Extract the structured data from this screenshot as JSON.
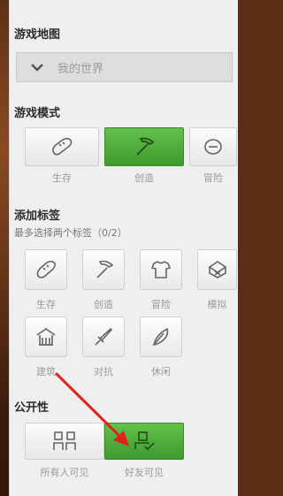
{
  "sections": {
    "map_title": "游戏地图",
    "mode_title": "游戏模式",
    "tags_title": "添加标签",
    "tags_hint": "最多选择两个标签（0/2）",
    "visibility_title": "公开性"
  },
  "map": {
    "selected": "我的世界"
  },
  "modes": [
    {
      "label": "生存",
      "icon": "bread-icon",
      "active": false
    },
    {
      "label": "创造",
      "icon": "pickaxe-icon",
      "active": true
    },
    {
      "label": "冒险",
      "icon": "compass-icon",
      "active": false
    }
  ],
  "tags": [
    {
      "label": "生存",
      "icon": "bread-icon"
    },
    {
      "label": "创造",
      "icon": "pickaxe-icon"
    },
    {
      "label": "冒险",
      "icon": "armor-icon"
    },
    {
      "label": "模拟",
      "icon": "cube-icon"
    },
    {
      "label": "建筑",
      "icon": "house-icon"
    },
    {
      "label": "对抗",
      "icon": "sword-icon"
    },
    {
      "label": "休闲",
      "icon": "feather-icon"
    }
  ],
  "visibility": [
    {
      "label": "所有人可见",
      "icon": "people-icon",
      "active": false
    },
    {
      "label": "好友可见",
      "icon": "friend-icon",
      "active": true
    }
  ],
  "colors": {
    "active_green": "#4caf3c",
    "annotation_arrow": "#e0241b"
  }
}
